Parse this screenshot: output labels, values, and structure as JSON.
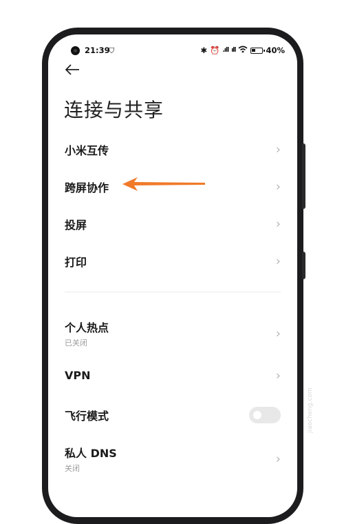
{
  "status_bar": {
    "time": "21:39",
    "signal_1": ".ıll",
    "signal_2": "ıll",
    "battery_percent": "40%",
    "battery_level": 0.4
  },
  "page": {
    "title": "连接与共享"
  },
  "items": [
    {
      "label": "小米互传"
    },
    {
      "label": "跨屏协作"
    },
    {
      "label": "投屏"
    },
    {
      "label": "打印"
    },
    {
      "label": "个人热点",
      "sub": "已关闭"
    },
    {
      "label": "VPN"
    },
    {
      "label": "飞行模式",
      "toggle": "off"
    },
    {
      "label": "私人 DNS",
      "sub": "关闭"
    }
  ],
  "annotation": {
    "color": "#f07a2a",
    "target": "跨屏协作"
  },
  "icons": {
    "back": "arrow-left-icon",
    "chevron": "chevron-right-icon",
    "bluetooth": "bluetooth-icon",
    "alarm": "alarm-icon",
    "wifi": "wifi-icon"
  }
}
